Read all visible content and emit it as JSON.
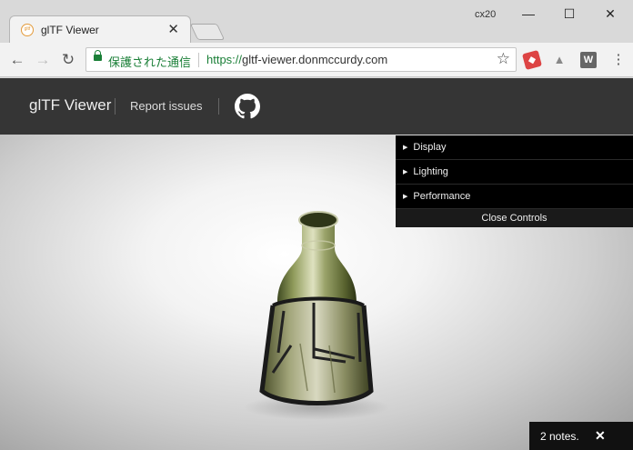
{
  "browser": {
    "tab": {
      "title": "glTF Viewer",
      "favicon_text": "gltf",
      "close": "✕"
    },
    "profile": "cx20",
    "window": {
      "minimize": "—",
      "maximize": "☐",
      "close": "✕"
    },
    "nav": {
      "back": "←",
      "forward": "→",
      "reload": "↻"
    },
    "omnibox": {
      "secure_label": "保護された通信",
      "url_scheme": "https://",
      "url_host": "gltf-viewer.donmccurdy.com"
    },
    "extensions": [
      {
        "name": "block-icon",
        "glyph": "◆"
      },
      {
        "name": "wizard-hat-icon",
        "glyph": "▲"
      },
      {
        "name": "w-extension-icon",
        "glyph": "W"
      }
    ],
    "menu": "⋮"
  },
  "header": {
    "title": "glTF Viewer",
    "report_link": "Report issues",
    "github_icon": "github-icon"
  },
  "controls": {
    "folders": [
      {
        "label": "Display"
      },
      {
        "label": "Lighting"
      },
      {
        "label": "Performance"
      }
    ],
    "close_label": "Close Controls"
  },
  "notes": {
    "text": "2 notes.",
    "close": "✕"
  },
  "colors": {
    "header_bg": "#353535",
    "controls_bg": "#000000",
    "secure_green": "#1a7f37"
  }
}
